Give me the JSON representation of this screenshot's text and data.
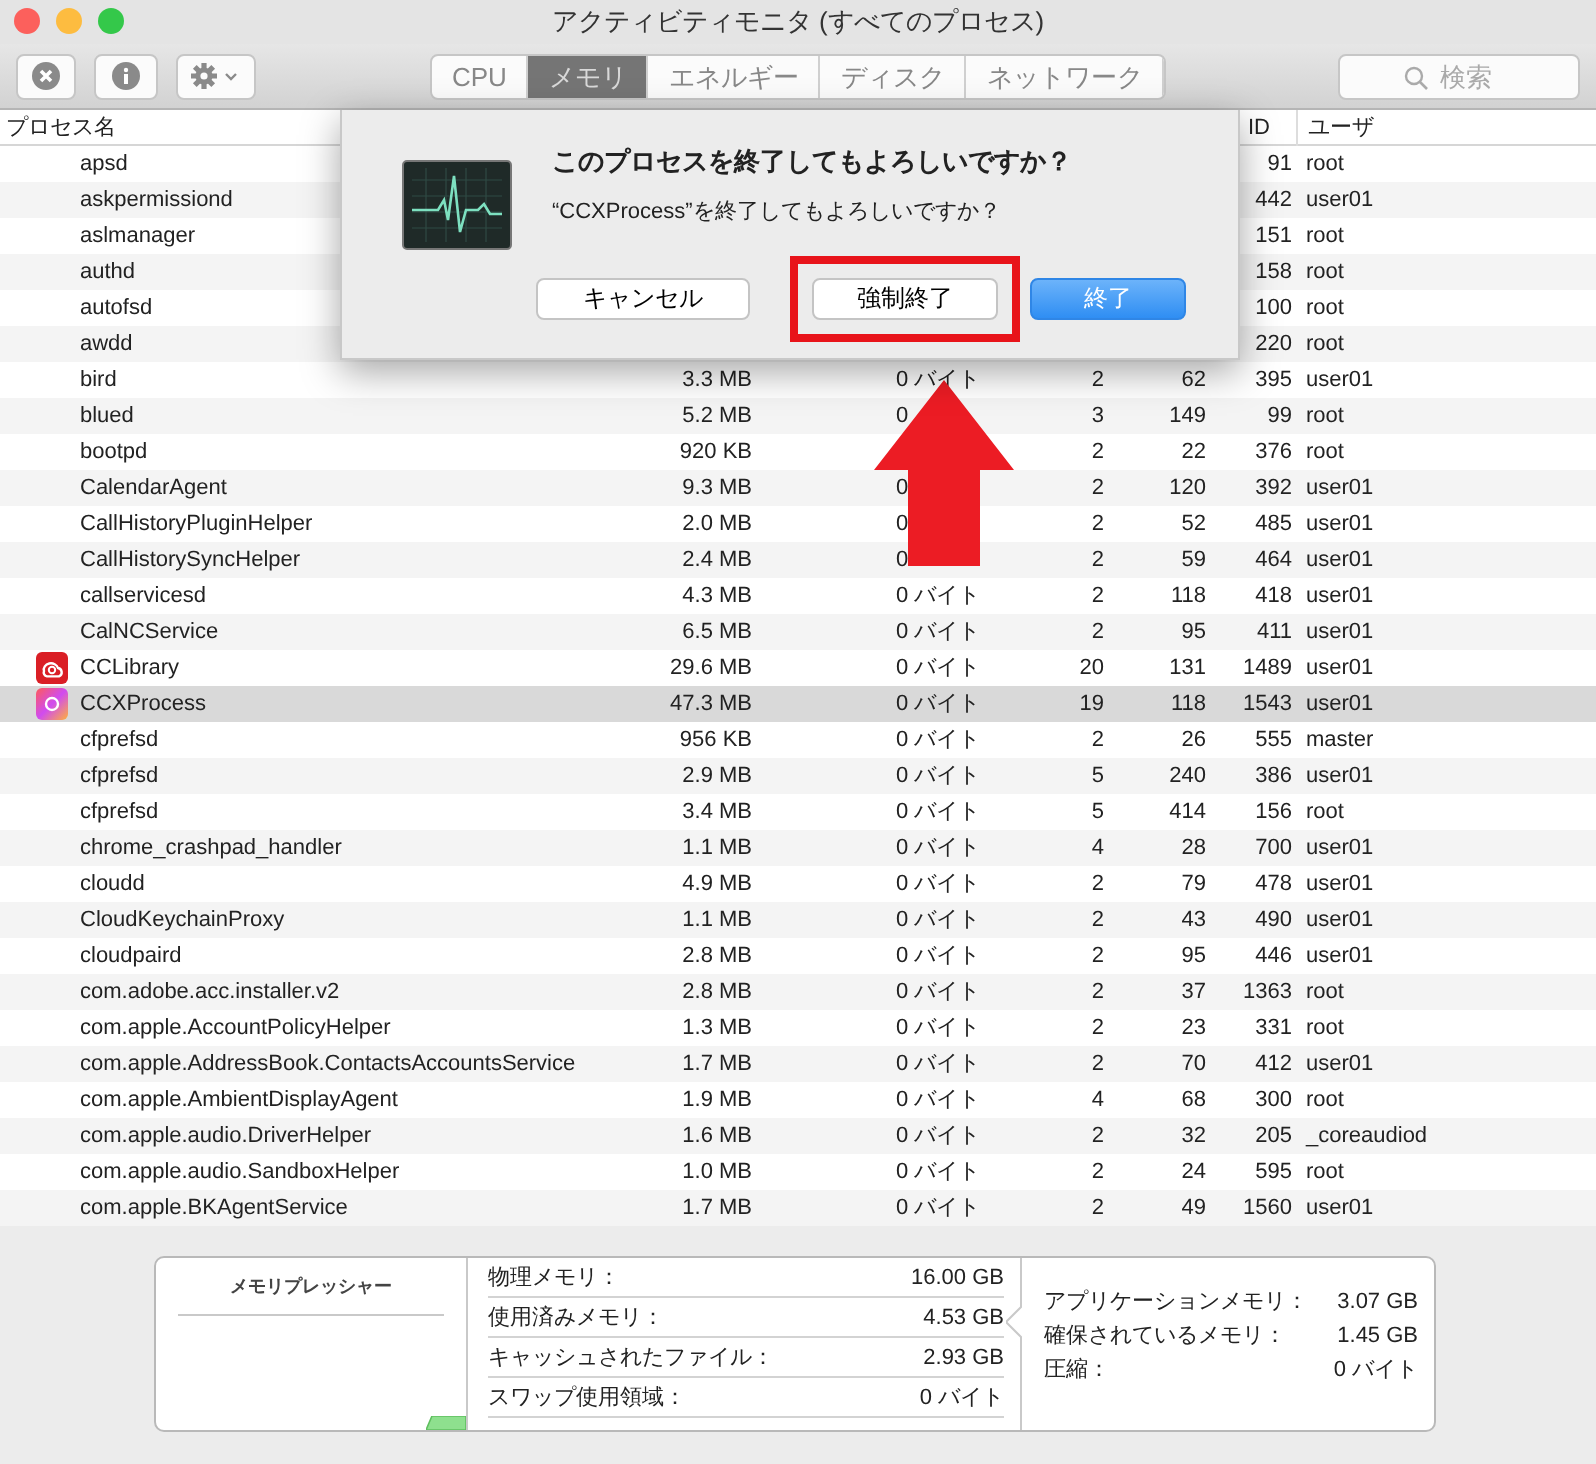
{
  "window": {
    "title": "アクティビティモニタ (すべてのプロセス)"
  },
  "toolbar": {
    "tabs": [
      {
        "label": "CPU",
        "selected": false
      },
      {
        "label": "メモリ",
        "selected": true
      },
      {
        "label": "エネルギー",
        "selected": false
      },
      {
        "label": "ディスク",
        "selected": false
      },
      {
        "label": "ネットワーク",
        "selected": false
      }
    ],
    "search": {
      "placeholder": "検索"
    }
  },
  "table": {
    "columns": [
      "プロセス名",
      "ID",
      "ユーザ"
    ],
    "rows": [
      {
        "name": "apsd",
        "pid": "91",
        "user": "root",
        "selected": false
      },
      {
        "name": "askpermissiond",
        "pid": "442",
        "user": "user01",
        "selected": false
      },
      {
        "name": "aslmanager",
        "pid": "151",
        "user": "root",
        "selected": false
      },
      {
        "name": "authd",
        "pid": "158",
        "user": "root",
        "selected": false
      },
      {
        "name": "autofsd",
        "pid": "100",
        "user": "root",
        "selected": false
      },
      {
        "name": "awdd",
        "pid": "220",
        "user": "root",
        "selected": false
      },
      {
        "name": "bird",
        "memory": "3.3 MB",
        "compressed": "0 バイト",
        "threads": "2",
        "ports": "62",
        "pid": "395",
        "user": "user01",
        "selected": false
      },
      {
        "name": "blued",
        "memory": "5.2 MB",
        "compressed": "0",
        "threads": "3",
        "ports": "149",
        "pid": "99",
        "user": "root",
        "selected": false
      },
      {
        "name": "bootpd",
        "memory": "920 KB",
        "threads": "2",
        "ports": "22",
        "pid": "376",
        "user": "root",
        "selected": false
      },
      {
        "name": "CalendarAgent",
        "memory": "9.3 MB",
        "compressed": "0",
        "threads": "2",
        "ports": "120",
        "pid": "392",
        "user": "user01",
        "selected": false
      },
      {
        "name": "CallHistoryPluginHelper",
        "memory": "2.0 MB",
        "compressed": "0",
        "threads": "2",
        "ports": "52",
        "pid": "485",
        "user": "user01",
        "selected": false
      },
      {
        "name": "CallHistorySyncHelper",
        "memory": "2.4 MB",
        "compressed": "0",
        "threads": "2",
        "ports": "59",
        "pid": "464",
        "user": "user01",
        "selected": false
      },
      {
        "name": "callservicesd",
        "memory": "4.3 MB",
        "compressed": "0 バイト",
        "threads": "2",
        "ports": "118",
        "pid": "418",
        "user": "user01",
        "selected": false
      },
      {
        "name": "CalNCService",
        "memory": "6.5 MB",
        "compressed": "0 バイト",
        "threads": "2",
        "ports": "95",
        "pid": "411",
        "user": "user01",
        "selected": false
      },
      {
        "name": "CCLibrary",
        "kind": "app",
        "memory": "29.6 MB",
        "compressed": "0 バイト",
        "threads": "20",
        "ports": "131",
        "pid": "1489",
        "user": "user01",
        "selected": false
      },
      {
        "name": "CCXProcess",
        "kind": "app",
        "memory": "47.3 MB",
        "compressed": "0 バイト",
        "threads": "19",
        "ports": "118",
        "pid": "1543",
        "user": "user01",
        "selected": true
      },
      {
        "name": "cfprefsd",
        "memory": "956 KB",
        "compressed": "0 バイト",
        "threads": "2",
        "ports": "26",
        "pid": "555",
        "user": "master",
        "selected": false
      },
      {
        "name": "cfprefsd",
        "memory": "2.9 MB",
        "compressed": "0 バイト",
        "threads": "5",
        "ports": "240",
        "pid": "386",
        "user": "user01",
        "selected": false
      },
      {
        "name": "cfprefsd",
        "memory": "3.4 MB",
        "compressed": "0 バイト",
        "threads": "5",
        "ports": "414",
        "pid": "156",
        "user": "root",
        "selected": false
      },
      {
        "name": "chrome_crashpad_handler",
        "memory": "1.1 MB",
        "compressed": "0 バイト",
        "threads": "4",
        "ports": "28",
        "pid": "700",
        "user": "user01",
        "selected": false
      },
      {
        "name": "cloudd",
        "memory": "4.9 MB",
        "compressed": "0 バイト",
        "threads": "2",
        "ports": "79",
        "pid": "478",
        "user": "user01",
        "selected": false
      },
      {
        "name": "CloudKeychainProxy",
        "memory": "1.1 MB",
        "compressed": "0 バイト",
        "threads": "2",
        "ports": "43",
        "pid": "490",
        "user": "user01",
        "selected": false
      },
      {
        "name": "cloudpaird",
        "memory": "2.8 MB",
        "compressed": "0 バイト",
        "threads": "2",
        "ports": "95",
        "pid": "446",
        "user": "user01",
        "selected": false
      },
      {
        "name": "com.adobe.acc.installer.v2",
        "memory": "2.8 MB",
        "compressed": "0 バイト",
        "threads": "2",
        "ports": "37",
        "pid": "1363",
        "user": "root",
        "selected": false
      },
      {
        "name": "com.apple.AccountPolicyHelper",
        "memory": "1.3 MB",
        "compressed": "0 バイト",
        "threads": "2",
        "ports": "23",
        "pid": "331",
        "user": "root",
        "selected": false
      },
      {
        "name": "com.apple.AddressBook.ContactsAccountsService",
        "memory": "1.7 MB",
        "compressed": "0 バイト",
        "threads": "2",
        "ports": "70",
        "pid": "412",
        "user": "user01",
        "selected": false
      },
      {
        "name": "com.apple.AmbientDisplayAgent",
        "memory": "1.9 MB",
        "compressed": "0 バイト",
        "threads": "4",
        "ports": "68",
        "pid": "300",
        "user": "root",
        "selected": false
      },
      {
        "name": "com.apple.audio.DriverHelper",
        "memory": "1.6 MB",
        "compressed": "0 バイト",
        "threads": "2",
        "ports": "32",
        "pid": "205",
        "user": "_coreaudiod",
        "selected": false
      },
      {
        "name": "com.apple.audio.SandboxHelper",
        "memory": "1.0 MB",
        "compressed": "0 バイト",
        "threads": "2",
        "ports": "24",
        "pid": "595",
        "user": "root",
        "selected": false
      },
      {
        "name": "com.apple.BKAgentService",
        "memory": "1.7 MB",
        "compressed": "0 バイト",
        "threads": "2",
        "ports": "49",
        "pid": "1560",
        "user": "user01",
        "selected": false
      }
    ]
  },
  "memory_panel": {
    "pressure_title": "メモリプレッシャー",
    "stats": [
      {
        "label": "物理メモリ：",
        "value": "16.00 GB"
      },
      {
        "label": "使用済みメモリ：",
        "value": "4.53 GB"
      },
      {
        "label": "キャッシュされたファイル：",
        "value": "2.93 GB"
      },
      {
        "label": "スワップ使用領域：",
        "value": "0 バイト"
      }
    ],
    "details": [
      {
        "label": "アプリケーションメモリ：",
        "value": "3.07 GB"
      },
      {
        "label": "確保されているメモリ：",
        "value": "1.45 GB"
      },
      {
        "label": "圧縮：",
        "value": "0 バイト"
      }
    ]
  },
  "dialog": {
    "title": "このプロセスを終了してもよろしいですか？",
    "message": "“CCXProcess”を終了してもよろしいですか？",
    "buttons": [
      {
        "label": "キャンセル",
        "kind": "plain"
      },
      {
        "label": "強制終了",
        "kind": "highlighted"
      },
      {
        "label": "終了",
        "kind": "default"
      }
    ]
  }
}
